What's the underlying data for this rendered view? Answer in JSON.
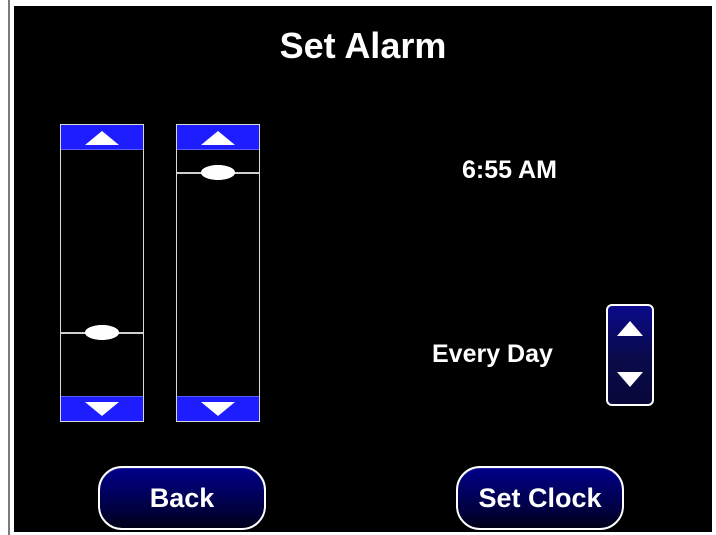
{
  "screen": {
    "title": "Set Alarm",
    "time_display": "6:55 AM",
    "repeat_display": "Every Day"
  },
  "sliders": {
    "hours": {
      "position_fraction": 0.74
    },
    "minutes": {
      "position_fraction": 0.09
    }
  },
  "buttons": {
    "back_label": "Back",
    "set_clock_label": "Set Clock"
  },
  "colors": {
    "background": "#000000",
    "arrow_blue": "#1d1dff",
    "button_blue": "#00008b",
    "text": "#ffffff"
  },
  "icons": {
    "up": "triangle-up-icon",
    "down": "triangle-down-icon",
    "thumb": "slider-thumb-icon"
  }
}
